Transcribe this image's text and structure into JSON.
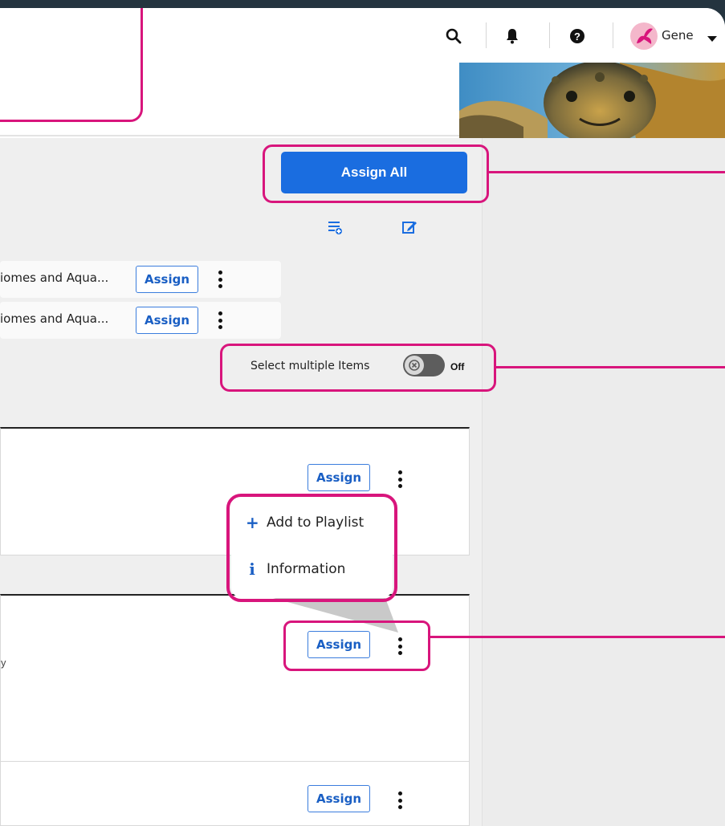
{
  "header": {
    "user_name": "Gene",
    "icons": [
      "search-icon",
      "bell-icon",
      "help-icon",
      "avatar",
      "caret-down-icon"
    ]
  },
  "toolbar": {
    "assign_all_label": "Assign All",
    "icons": [
      "playlist-add-icon",
      "edit-icon"
    ]
  },
  "list": {
    "items": [
      {
        "title": "iomes and Aqua...",
        "assign_label": "Assign"
      },
      {
        "title": "iomes and Aqua...",
        "assign_label": "Assign"
      }
    ]
  },
  "select_multiple": {
    "label": "Select multiple Items",
    "state": "Off"
  },
  "cards": [
    {
      "assign_label": "Assign"
    },
    {
      "assign_label": "Assign",
      "snippet": "y"
    },
    {
      "assign_label": "Assign"
    }
  ],
  "context_menu": {
    "items": [
      {
        "label": "Add to Playlist",
        "icon": "plus-icon"
      },
      {
        "label": "Information",
        "icon": "info-icon"
      }
    ]
  },
  "colors": {
    "highlight": "#d8157c",
    "primary": "#1a6de0",
    "frame": "#24343f"
  }
}
